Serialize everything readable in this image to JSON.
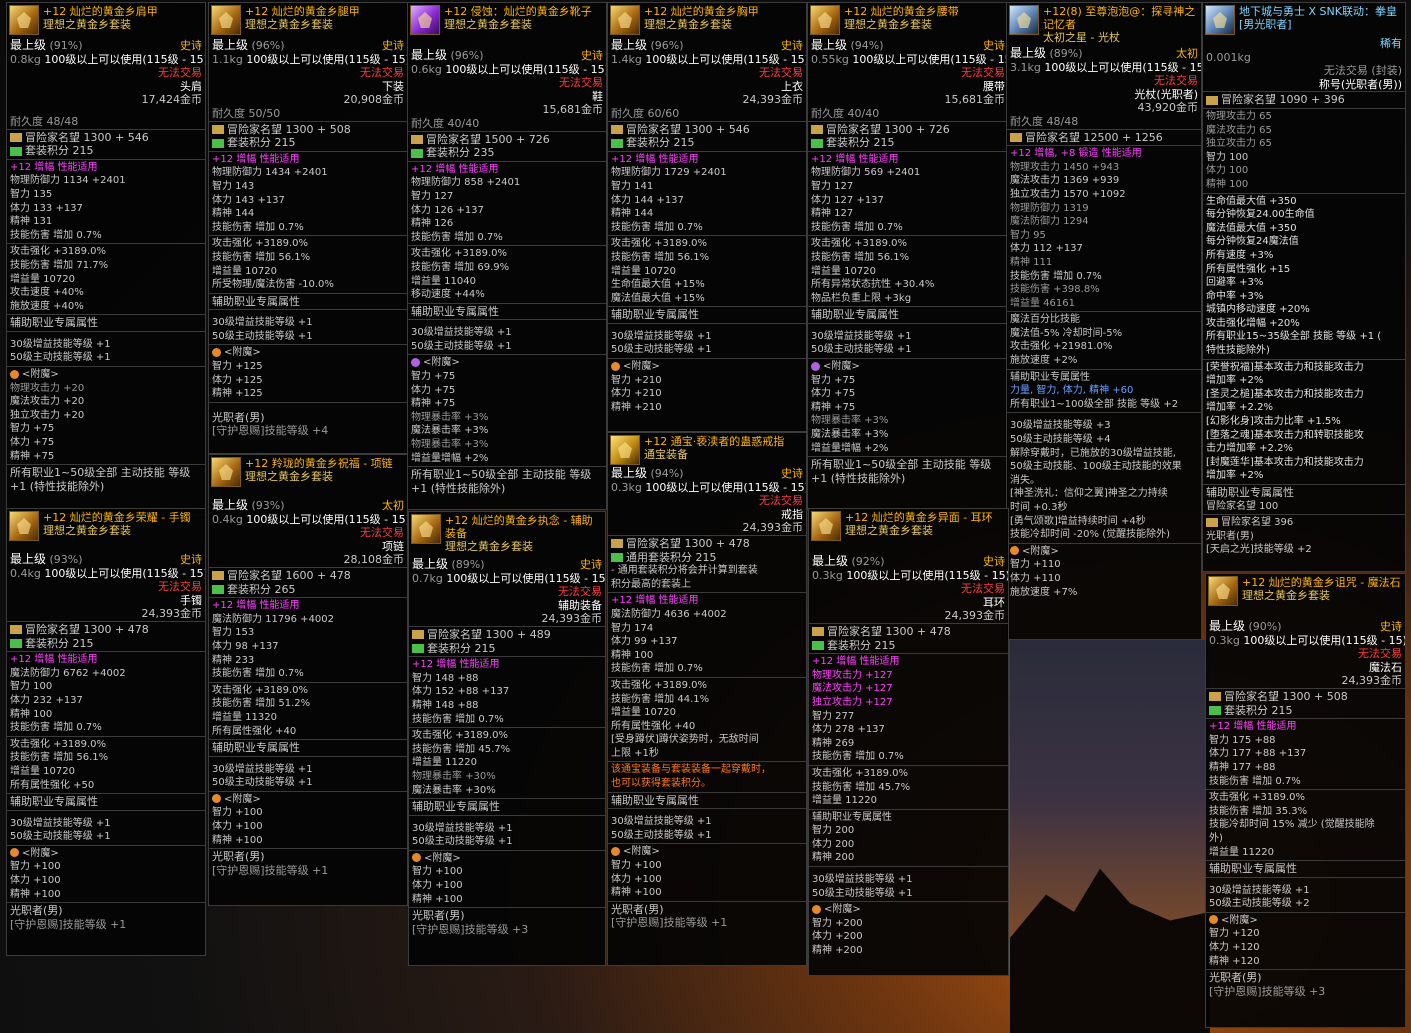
{
  "c1": {
    "prefix": "+12",
    "name": "灿烂的黄金乡肩甲",
    "set": "理想之黄金乡套装",
    "lv_label": "最上级",
    "lv_pct": "(91%)",
    "rarity": "史诗",
    "wt": "0.8kg",
    "req": "100级以上可以使用(115级 - 15)",
    "trade": "无法交易",
    "slot": "头肩",
    "price": "17,424金币",
    "dura": "耐久度 48/48",
    "fame": "冒险家名望 1300 + 546",
    "setpts": "套装积分 215",
    "amp": "+12 增幅 性能适用",
    "stats": [
      "物理防御力 1134 +2401",
      "智力 135",
      "体力 133 +137",
      "精神 131",
      "技能伤害 增加 0.7%"
    ],
    "atk": [
      "攻击强化 +3189.0%",
      "技能伤害 增加 71.7%",
      "增益量 10720",
      "攻击速度 +40%",
      "施放速度 +40%"
    ],
    "sup": "辅助职业专属属性",
    "sup_l": [
      "30级增益技能等级 +1",
      "50级主动技能等级 +1"
    ],
    "ench": "<附魔>",
    "ench_l": [
      "物理攻击力 +20",
      "魔法攻击力 +20",
      "独立攻击力 +20",
      "智力 +75",
      "体力 +75",
      "精神 +75"
    ],
    "foot": [
      "所有职业1~50级全部 主动技能 等级",
      "+1 (特性技能除外)"
    ]
  },
  "c2": {
    "prefix": "+12",
    "name": "灿烂的黄金乡腿甲",
    "set": "理想之黄金乡套装",
    "lv_label": "最上级",
    "lv_pct": "(96%)",
    "rarity": "史诗",
    "wt": "1.1kg",
    "req": "100级以上可以使用(115级 - 15)",
    "trade": "无法交易",
    "slot": "下装",
    "price": "20,908金币",
    "dura": "耐久度 50/50",
    "fame": "冒险家名望 1300 + 508",
    "setpts": "套装积分 215",
    "amp": "+12 增幅 性能适用",
    "stats": [
      "物理防御力 1434 +2401",
      "智力 143",
      "体力 143 +137",
      "精神 144",
      "技能伤害 增加 0.7%"
    ],
    "atk": [
      "攻击强化 +3189.0%",
      "技能伤害 增加 56.1%",
      "增益量 10720",
      "所受物理/魔法伤害 -10.0%"
    ],
    "sup": "辅助职业专属属性",
    "sup_l": [
      "30级增益技能等级 +1",
      "50级主动技能等级 +1"
    ],
    "ench": "<附魔>",
    "ench_l": [
      "智力 +125",
      "体力 +125",
      "精神 +125"
    ],
    "foot": [
      "光职者(男)",
      "[守护恩赐]技能等级 +4"
    ]
  },
  "c3": {
    "prefix": "+12",
    "name": "侵蚀：灿烂的黄金乡靴子",
    "set": "理想之黄金乡套装",
    "lv_label": "最上级",
    "lv_pct": "(96%)",
    "rarity": "史诗",
    "wt": "0.6kg",
    "req": "100级以上可以使用(115级 - 15)",
    "trade": "无法交易",
    "slot": "鞋",
    "price": "15,681金币",
    "dura": "耐久度 40/40",
    "fame": "冒险家名望 1500 + 726",
    "setpts": "套装积分 235",
    "amp": "+12 增幅 性能适用",
    "stats": [
      "物理防御力 858 +2401",
      "智力 127",
      "体力 126 +137",
      "精神 126",
      "技能伤害 增加 0.7%"
    ],
    "atk": [
      "攻击强化 +3189.0%",
      "技能伤害 增加 69.9%",
      "增益量 11040",
      "移动速度 +44%"
    ],
    "sup": "辅助职业专属属性",
    "sup_l": [
      "30级增益技能等级 +1",
      "50级主动技能等级 +1"
    ],
    "ench": "<附魔>",
    "ench_l": [
      "智力 +75",
      "体力 +75",
      "精神 +75",
      "物理暴击率 +3%",
      "魔法暴击率 +3%",
      "物理暴击率 +3%",
      "增益量增幅 +2%"
    ],
    "foot": [
      "所有职业1~50级全部 主动技能 等级",
      "+1 (特性技能除外)"
    ]
  },
  "c4": {
    "prefix": "+12",
    "name": "灿烂的黄金乡胸甲",
    "set": "理想之黄金乡套装",
    "lv_label": "最上级",
    "lv_pct": "(96%)",
    "rarity": "史诗",
    "wt": "1.4kg",
    "req": "100级以上可以使用(115级 - 15)",
    "trade": "无法交易",
    "slot": "上衣",
    "price": "24,393金币",
    "dura": "耐久度 60/60",
    "fame": "冒险家名望 1300 + 546",
    "setpts": "套装积分 215",
    "amp": "+12 增幅 性能适用",
    "stats": [
      "物理防御力 1729 +2401",
      "智力 141",
      "体力 144 +137",
      "精神 144",
      "技能伤害 增加 0.7%"
    ],
    "atk": [
      "攻击强化 +3189.0%",
      "技能伤害 增加 56.1%",
      "增益量 10720",
      "生命值最大值 +15%",
      "魔法值最大值 +15%"
    ],
    "sup": "辅助职业专属属性",
    "sup_l": [
      "30级增益技能等级 +1",
      "50级主动技能等级 +1"
    ],
    "ench": "<附魔>",
    "ench_l": [
      "智力 +210",
      "体力 +210",
      "精神 +210"
    ]
  },
  "c5": {
    "prefix": "+12",
    "name": "灿烂的黄金乡腰带",
    "set": "理想之黄金乡套装",
    "lv_label": "最上级",
    "lv_pct": "(94%)",
    "rarity": "史诗",
    "wt": "0.55kg",
    "req": "100级以上可以使用(115级 - 15)",
    "trade": "无法交易",
    "slot": "腰带",
    "price": "15,681金币",
    "dura": "耐久度 40/40",
    "fame": "冒险家名望 1300 + 726",
    "setpts": "套装积分 215",
    "amp": "+12 增幅 性能适用",
    "stats": [
      "物理防御力 569 +2401",
      "智力 127",
      "体力 127 +137",
      "精神 127",
      "技能伤害 增加 0.7%"
    ],
    "atk": [
      "攻击强化 +3189.0%",
      "技能伤害 增加 56.1%",
      "增益量 10720",
      "所有异常状态抗性 +30.4%",
      "物品栏负重上限 +3kg"
    ],
    "sup": "辅助职业专属属性",
    "sup_l": [
      "30级增益技能等级 +1",
      "50级主动技能等级 +1"
    ],
    "ench": "<附魔>",
    "ench_l": [
      "智力 +75",
      "体力 +75",
      "精神 +75",
      "物理暴击率 +3%",
      "魔法暴击率 +3%",
      "增益量增幅 +2%"
    ],
    "foot": [
      "所有职业1~50级全部 主动技能 等级",
      "+1 (特性技能除外)"
    ]
  },
  "c6": {
    "prefix": "+12(8)",
    "name": "至尊泡泡@：探寻神之记忆者",
    "sub": "太初之星 - 光杖",
    "lv_label": "最上级",
    "lv_pct": "(89%)",
    "rarity": "太初",
    "wt": "3.1kg",
    "req": "100级以上可以使用(115级 - 15)",
    "trade": "无法交易",
    "slot": "光杖(光职者)",
    "price": "43,920金币",
    "dura": "耐久度 48/48",
    "fame": "冒险家名望 12500 + 1256",
    "amp": "+12 增幅, +8 锻造 性能适用",
    "stats": [
      "物理攻击力 1450 +943",
      "魔法攻击力 1369 +939",
      "独立攻击力 1570 +1092",
      "物理防御力 1319",
      "魔法防御力 1294",
      "智力 95",
      "体力 112 +137",
      "精神 111",
      "技能伤害 增加 0.7%",
      "技能伤害 +398.8%",
      "增益量 46161"
    ],
    "magic": [
      "魔法百分比技能",
      "魔法值-5% 冷却时间-5%",
      "攻击强化 +21981.0%",
      "施放速度 +2%"
    ],
    "sup": "辅助职业专属属性",
    "sup_l": [
      "力量, 智力, 体力, 精神 +60",
      "所有职业1~100级全部 技能 等级 +2"
    ],
    "ext": [
      "30级增益技能等级 +3",
      "50级主动技能等级 +4",
      "解除穿戴时，已施放的30级增益技能,",
      "50级主动技能、100级主动技能的效果",
      "消失。",
      "[神圣洗礼：信仰之翼]神圣之力持续",
      "时间 +0.3秒",
      "[勇气颂歌]增益持续时间 +4秒",
      "技能冷却时间 -20% (觉醒技能除外)"
    ],
    "ench": "<附魔>",
    "ench_l": [
      "智力 +110",
      "体力 +110",
      "施放速度 +7%"
    ]
  },
  "c7": {
    "name": "地下城与勇士 X SNK联动：拳皇[男光职者]",
    "rarity": "稀有",
    "wt": "0.001kg",
    "trade": "无法交易 (封装)",
    "slot": "称号(光职者(男))",
    "fame": "冒险家名望 1090 + 396",
    "stats": [
      "物理攻击力 65",
      "魔法攻击力 65",
      "独立攻击力 65",
      "智力 100",
      "体力 100",
      "精神 100"
    ],
    "effects": [
      "生命值最大值 +350",
      "每分钟恢复24.00生命值",
      "魔法值最大值 +350",
      "每分钟恢复24魔法值",
      "所有速度 +3%",
      "所有属性强化 +15",
      "回避率 +3%",
      "命中率 +3%",
      "城镇内移动速度 +20%",
      "攻击强化增幅 +20%",
      "所有职业15~35级全部 技能 等级 +1 (",
      "特性技能除外)"
    ],
    "skills": [
      "[荣誉祝福]基本攻击力和技能攻击力",
      "增加率 +2%",
      "[圣灵之槌]基本攻击力和技能攻击力",
      "增加率 +2.2%",
      "[幻影化身]攻击力比率 +1.5%",
      "[堕落之魂]基本攻击力和转职技能攻",
      "击力增加率 +2.2%",
      "[封魔莲华]基本攻击力和技能攻击力",
      "增加率 +2%"
    ],
    "sup": "辅助职业专属属性",
    "sup_l": [
      "冒险家名望 100"
    ],
    "fame2": "冒险家名望 396",
    "foot": [
      "光职者(男)",
      "[天启之光]技能等级 +2"
    ]
  },
  "c8": {
    "prefix": "+12",
    "name": "灿烂的黄金乡荣耀 - 手镯",
    "set": "理想之黄金乡套装",
    "lv_label": "最上级",
    "lv_pct": "(93%)",
    "rarity": "史诗",
    "wt": "0.4kg",
    "req": "100级以上可以使用(115级 - 15)",
    "trade": "无法交易",
    "slot": "手镯",
    "price": "24,393金币",
    "fame": "冒险家名望 1300 + 478",
    "setpts": "套装积分 215",
    "amp": "+12 增幅 性能适用",
    "stats": [
      "魔法防御力 6762 +4002",
      "智力 100",
      "体力 232 +137",
      "精神 100",
      "技能伤害 增加 0.7%"
    ],
    "atk": [
      "攻击强化 +3189.0%",
      "技能伤害 增加 56.1%",
      "增益量 10720",
      "所有属性强化 +50"
    ],
    "sup": "辅助职业专属属性",
    "sup_l": [
      "30级增益技能等级 +1",
      "50级主动技能等级 +1"
    ],
    "ench": "<附魔>",
    "ench_l": [
      "智力 +100",
      "体力 +100",
      "精神 +100"
    ],
    "foot": [
      "光职者(男)",
      "[守护恩赐]技能等级 +1"
    ]
  },
  "c9": {
    "prefix": "+12",
    "name": "羚珑的黄金乡祝福 - 项链",
    "set": "理想之黄金乡套装",
    "lv_label": "最上级",
    "lv_pct": "(93%)",
    "rarity": "太初",
    "wt": "0.4kg",
    "req": "100级以上可以使用(115级 - 15)",
    "trade": "无法交易",
    "slot": "项链",
    "price": "28,108金币",
    "fame": "冒险家名望 1600 + 478",
    "setpts": "套装积分 265",
    "amp": "+12 增幅 性能适用",
    "stats": [
      "魔法防御力 11796 +4002",
      "智力 153",
      "体力 98 +137",
      "精神 233",
      "技能伤害 增加 0.7%"
    ],
    "atk": [
      "攻击强化 +3189.0%",
      "技能伤害 增加 51.2%",
      "增益量 11320",
      "所有属性强化 +40"
    ],
    "sup": "辅助职业专属属性",
    "sup_l": [
      "30级增益技能等级 +1",
      "50级主动技能等级 +1"
    ],
    "ench": "<附魔>",
    "ench_l": [
      "智力 +100",
      "体力 +100",
      "精神 +100"
    ],
    "foot": [
      "光职者(男)",
      "[守护恩赐]技能等级 +1"
    ]
  },
  "c10": {
    "prefix": "+12",
    "name": "灿烂的黄金乡执念 - 辅助装备",
    "set": "理想之黄金乡套装",
    "lv_label": "最上级",
    "lv_pct": "(89%)",
    "rarity": "史诗",
    "wt": "0.7kg",
    "req": "100级以上可以使用(115级 - 15)",
    "trade": "无法交易",
    "slot": "辅助装备",
    "price": "24,393金币",
    "fame": "冒险家名望 1300 + 489",
    "setpts": "套装积分 215",
    "amp": "+12 增幅 性能适用",
    "stats": [
      "智力 148 +88",
      "体力 152 +88 +137",
      "精神 148 +88",
      "技能伤害 增加 0.7%"
    ],
    "atk": [
      "攻击强化 +3189.0%",
      "技能伤害 增加 45.7%",
      "增益量 11220",
      "物理暴击率 +30%",
      "魔法暴击率 +30%"
    ],
    "sup": "辅助职业专属属性",
    "sup_l": [
      "30级增益技能等级 +1",
      "50级主动技能等级 +1"
    ],
    "ench": "<附魔>",
    "ench_l": [
      "智力 +100",
      "体力 +100",
      "精神 +100"
    ],
    "foot": [
      "光职者(男)",
      "[守护恩赐]技能等级 +3"
    ]
  },
  "c11": {
    "prefix": "+12",
    "name": "通宝·亵渎者的蛊惑戒指",
    "set": "通宝装备",
    "badge": "通宝",
    "lv_label": "最上级",
    "lv_pct": "(94%)",
    "rarity": "史诗",
    "wt": "0.3kg",
    "req": "100级以上可以使用(115级 - 15)",
    "trade": "无法交易",
    "slot": "戒指",
    "price": "24,393金币",
    "fame": "冒险家名望 1300 + 478",
    "setpts": "通用套装积分 215",
    "note": [
      "- 通用套装积分将会并计算到套装",
      "积分最高的套装上"
    ],
    "amp": "+12 增幅 性能适用",
    "stats": [
      "魔法防御力 4636 +4002",
      "智力 174",
      "体力 99 +137",
      "精神 100",
      "技能伤害 增加 0.7%"
    ],
    "atk": [
      "攻击强化 +3189.0%",
      "技能伤害 增加 44.1%",
      "增益量 10720",
      "所有属性强化 +40",
      "[受身蹲伏]蹲伏姿势时，无敌时间",
      "上限 +1秒"
    ],
    "warn": [
      "该通宝装备与套装装备一起穿戴时，",
      "也可以获得套装积分。"
    ],
    "sup": "辅助职业专属属性",
    "sup_l": [
      "30级增益技能等级 +1",
      "50级主动技能等级 +1"
    ],
    "ench": "<附魔>",
    "ench_l": [
      "智力 +100",
      "体力 +100",
      "精神 +100"
    ],
    "foot": [
      "光职者(男)",
      "[守护恩赐]技能等级 +1"
    ]
  },
  "c12": {
    "prefix": "+12",
    "name": "灿烂的黄金乡异面 - 耳环",
    "set": "理想之黄金乡套装",
    "lv_label": "最上级",
    "lv_pct": "(92%)",
    "rarity": "史诗",
    "wt": "0.3kg",
    "req": "100级以上可以使用(115级 - 15)",
    "trade": "无法交易",
    "slot": "耳环",
    "price": "24,393金币",
    "fame": "冒险家名望 1300 + 478",
    "setpts": "套装积分 215",
    "amp": "+12 增幅 性能适用",
    "stats": [
      "物理攻击力 +127",
      "魔法攻击力 +127",
      "独立攻击力 +127",
      "智力 277",
      "体力 278 +137",
      "精神 269",
      "技能伤害 增加 0.7%"
    ],
    "atk": [
      "攻击强化 +3189.0%",
      "技能伤害 增加 45.7%",
      "增益量 11220"
    ],
    "sup": "辅助职业专属属性",
    "sup_l": [
      "智力 200",
      "体力 200",
      "精神 200"
    ],
    "ext": [
      "30级增益技能等级 +1",
      "50级主动技能等级 +1"
    ],
    "ench": "<附魔>",
    "ench_l": [
      "智力 +200",
      "体力 +200",
      "精神 +200"
    ]
  },
  "c13": {
    "prefix": "+12",
    "name": "灿烂的黄金乡诅咒 - 魔法石",
    "set": "理想之黄金乡套装",
    "lv_label": "最上级",
    "lv_pct": "(90%)",
    "rarity": "史诗",
    "wt": "0.3kg",
    "req": "100级以上可以使用(115级 - 15)",
    "trade": "无法交易",
    "slot": "魔法石",
    "price": "24,393金币",
    "fame": "冒险家名望 1300 + 508",
    "setpts": "套装积分 215",
    "amp": "+12 增幅 性能适用",
    "stats": [
      "智力 175 +88",
      "体力 177 +88 +137",
      "精神 177 +88",
      "技能伤害 增加 0.7%"
    ],
    "atk": [
      "攻击强化 +3189.0%",
      "技能伤害 增加 35.3%",
      "技能冷却时间 15% 减少 (觉醒技能除",
      "外)",
      "增益量 11220"
    ],
    "sup": "辅助职业专属属性",
    "sup_l": [
      "30级增益技能等级 +1",
      "50级主动技能等级 +2"
    ],
    "ench": "<附魔>",
    "ench_l": [
      "智力 +120",
      "体力 +120",
      "精神 +120"
    ],
    "foot": [
      "光职者(男)",
      "[守护恩赐]技能等级 +3"
    ]
  },
  "colors": {
    "rarity_epic": "#ffb400",
    "amp_pink": "#ff40ff",
    "green_bonus": "#7ce07c",
    "red_trade": "#ff3c3c"
  }
}
